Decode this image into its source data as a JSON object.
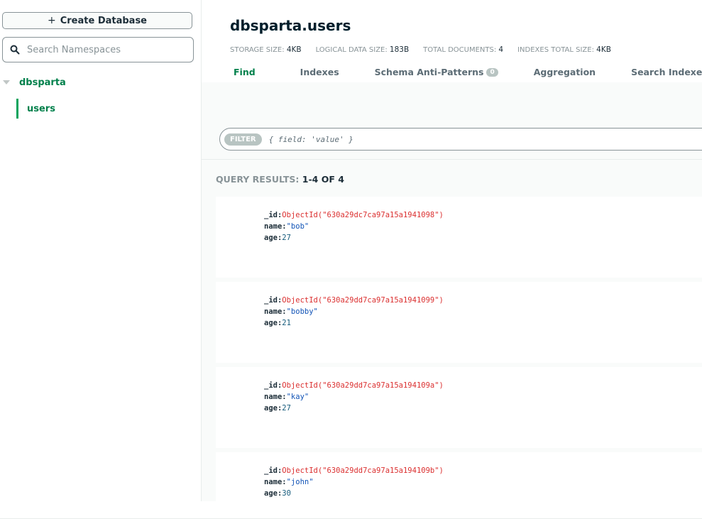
{
  "sidebar": {
    "create_button": {
      "icon": "plus-icon",
      "label": "Create Database"
    },
    "search": {
      "placeholder": "Search Namespaces",
      "value": ""
    },
    "databases": [
      {
        "name": "dbsparta",
        "collections": [
          "users"
        ]
      }
    ]
  },
  "main": {
    "title": "dbsparta.users",
    "stats": [
      {
        "label": "STORAGE SIZE:",
        "value": "4KB"
      },
      {
        "label": "LOGICAL DATA SIZE:",
        "value": "183B"
      },
      {
        "label": "TOTAL DOCUMENTS:",
        "value": "4"
      },
      {
        "label": "INDEXES TOTAL SIZE:",
        "value": "4KB"
      }
    ],
    "tabs": [
      {
        "label": "Find",
        "active": true
      },
      {
        "label": "Indexes"
      },
      {
        "label": "Schema Anti-Patterns",
        "badge": "0"
      },
      {
        "label": "Aggregation"
      },
      {
        "label": "Search Indexes",
        "status_dot": true
      }
    ],
    "filter": {
      "label": "FILTER",
      "placeholder": "{ field: 'value' }"
    },
    "results": {
      "label": "QUERY RESULTS:",
      "count": "1-4 OF 4"
    },
    "documents": [
      {
        "_id": "ObjectId(\"630a29dc7ca97a15a1941098\")",
        "name": "\"bob\"",
        "age": "27"
      },
      {
        "_id": "ObjectId(\"630a29dd7ca97a15a1941099\")",
        "name": "\"bobby\"",
        "age": "21"
      },
      {
        "_id": "ObjectId(\"630a29dd7ca97a15a194109a\")",
        "name": "\"kay\"",
        "age": "27"
      },
      {
        "_id": "ObjectId(\"630a29dd7ca97a15a194109b\")",
        "name": "\"john\"",
        "age": "30"
      }
    ],
    "field_keys": {
      "id": "_id:",
      "name": "name:",
      "age": "age:"
    }
  },
  "colors": {
    "accent": "#00804b",
    "objectid": "#db3030",
    "string": "#1254b7"
  }
}
